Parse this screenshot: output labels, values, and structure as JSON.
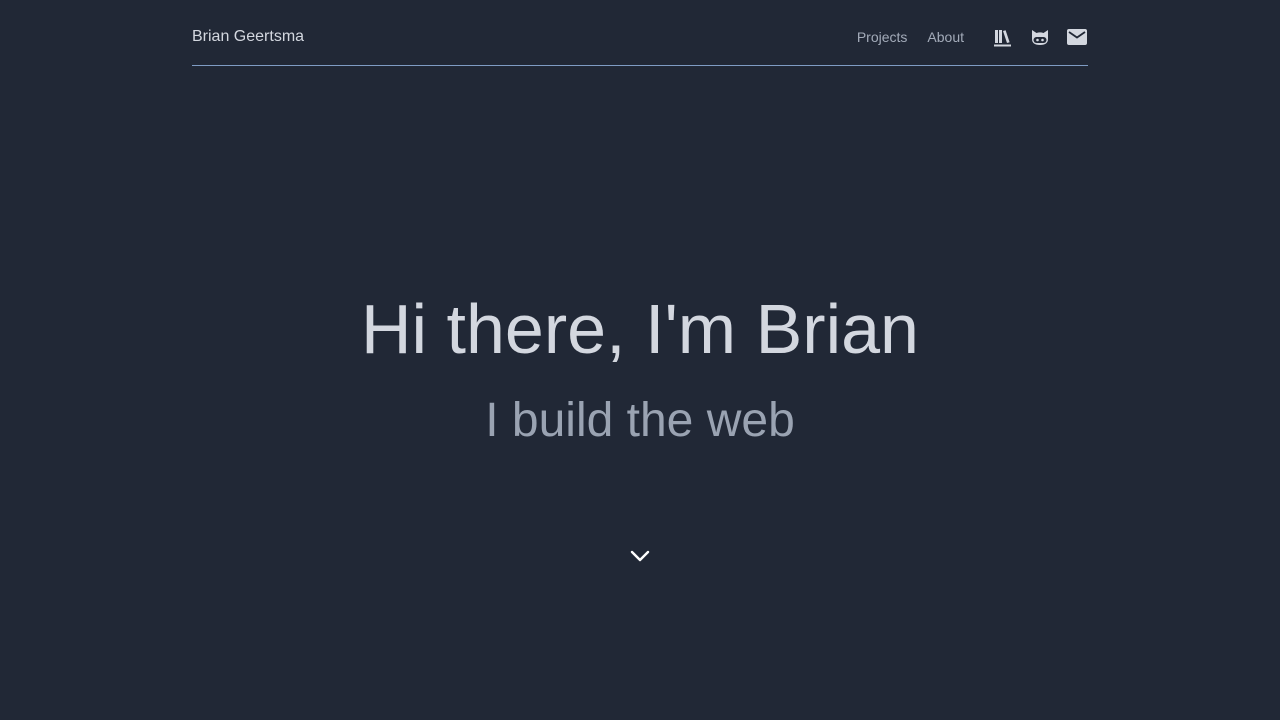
{
  "header": {
    "brand": "Brian Geertsma",
    "links": [
      {
        "label": "Projects"
      },
      {
        "label": "About"
      }
    ],
    "icons": [
      "library-icon",
      "github-icon",
      "mail-icon"
    ]
  },
  "hero": {
    "title": "Hi there, I'm Brian",
    "subtitle": "I build the web"
  },
  "scroll_icon": "chevron-down-icon",
  "colors": {
    "background": "#212836",
    "text_primary": "#d3d7df",
    "text_secondary": "#9aa3b2",
    "nav_link": "#a3abb9",
    "divider": "#7f9cc4"
  }
}
